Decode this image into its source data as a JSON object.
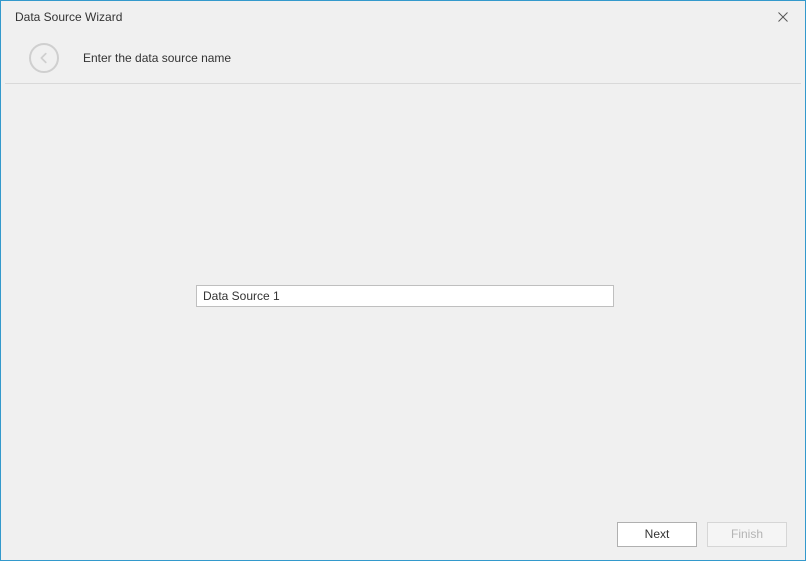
{
  "window": {
    "title": "Data Source Wizard"
  },
  "header": {
    "instruction": "Enter the data source name"
  },
  "form": {
    "data_source_name": "Data Source 1"
  },
  "footer": {
    "next_label": "Next",
    "finish_label": "Finish"
  }
}
